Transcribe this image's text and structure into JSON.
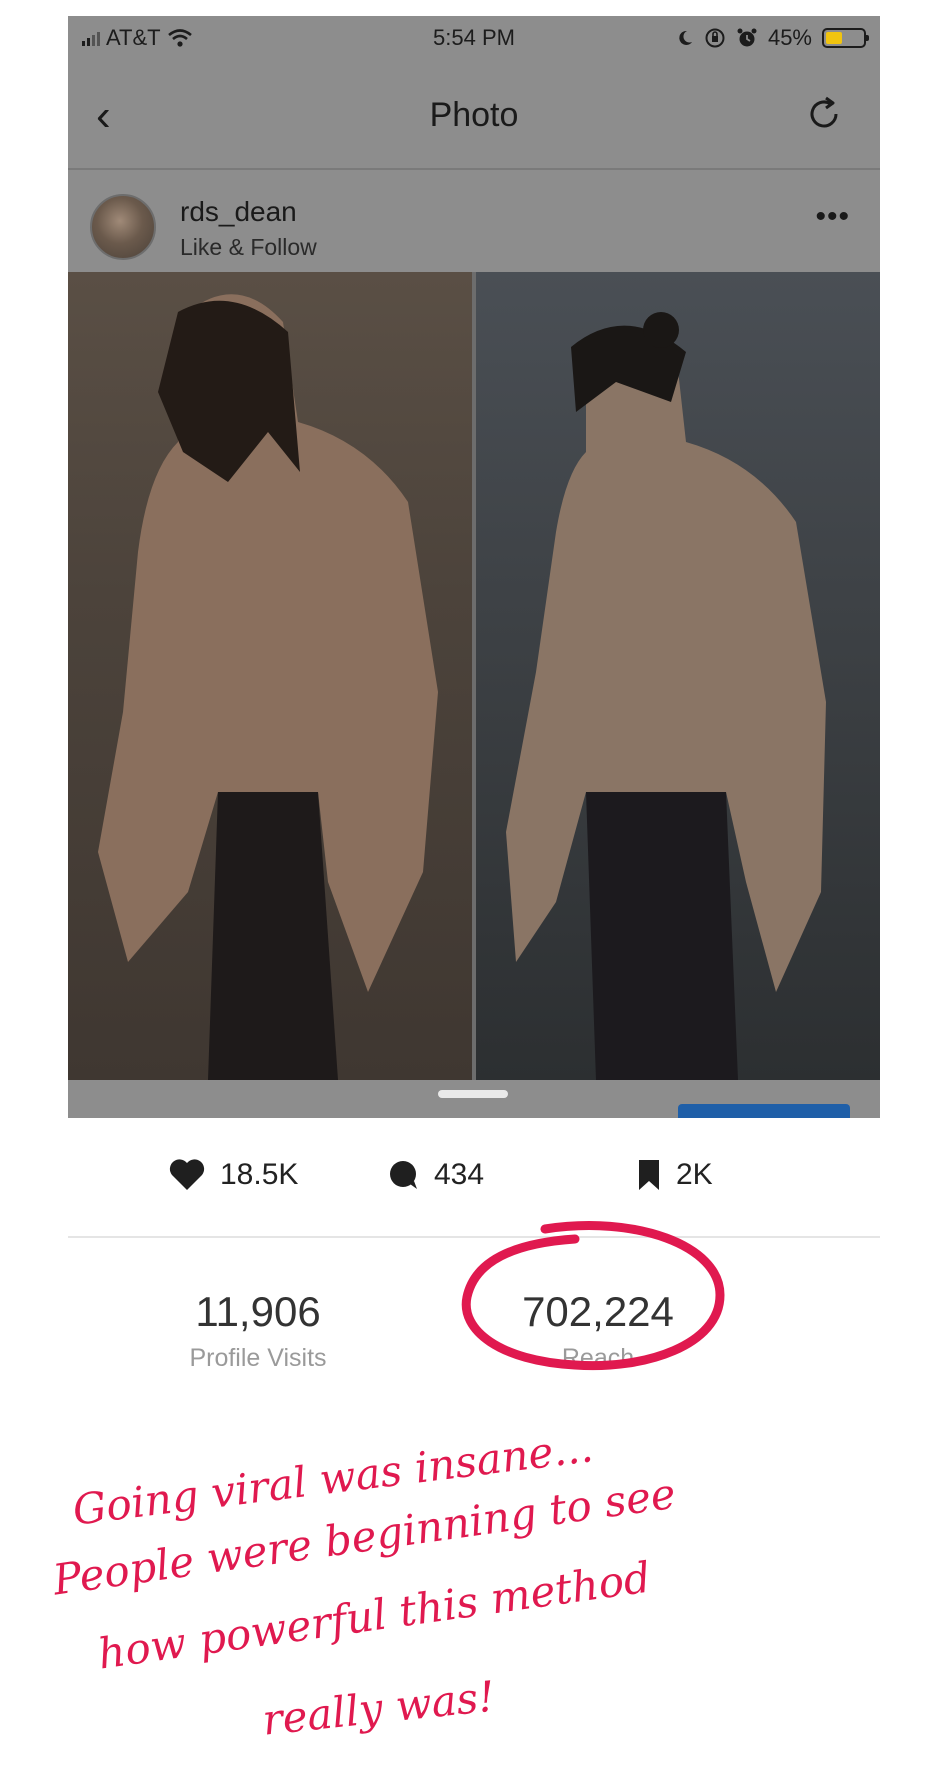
{
  "status_bar": {
    "carrier": "AT&T",
    "time": "5:54 PM",
    "battery": "45%",
    "battery_level": 0.45,
    "icons": [
      "signal-icon",
      "wifi-icon",
      "moon-icon",
      "orientation-lock-icon",
      "alarm-icon",
      "battery-icon"
    ]
  },
  "navbar": {
    "back_glyph": "‹",
    "title": "Photo",
    "refresh_icon": "refresh-icon"
  },
  "post": {
    "username": "rds_dean",
    "subtitle": "Like & Follow",
    "more_glyph": "•••"
  },
  "stats": {
    "likes": "18.5K",
    "comments": "434",
    "saves": "2K"
  },
  "insights": {
    "profile_visits_value": "11,906",
    "profile_visits_label": "Profile Visits",
    "reach_value": "702,224",
    "reach_label": "Reach"
  },
  "annotation": {
    "line1": "Going viral was insane...",
    "line2": "People were beginning to see",
    "line3": "how powerful this method",
    "line4": "really was!",
    "color": "#e0194f"
  }
}
